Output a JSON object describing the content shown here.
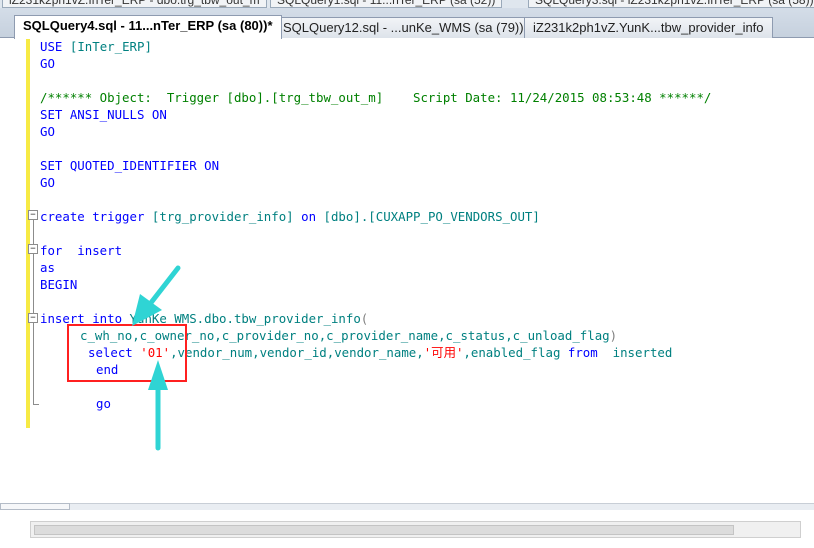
{
  "top_strip": {
    "tabs": [
      "iZ231k2ph1vZ.InTer_ERP - dbo.trg_tbw_out_m",
      "SQLQuery1.sql - 11...nTer_ERP (sa (52))",
      "SQLQuery3.sql - iZ231k2ph1vZ.InTer_ERP (sa (58))"
    ]
  },
  "tabs": [
    {
      "label": "SQLQuery4.sql - 11...nTer_ERP (sa (80))*",
      "active": true
    },
    {
      "label": "SQLQuery12.sql - ...unKe_WMS (sa (79))",
      "active": false
    },
    {
      "label": "iZ231k2ph1vZ.YunK...tbw_provider_info",
      "active": false
    }
  ],
  "code": {
    "l1_kw": "USE",
    "l1_db": "[InTer_ERP]",
    "l2_kw": "GO",
    "l4_comment": "/****** Object:  Trigger [dbo].[trg_tbw_out_m]    Script Date: 11/24/2015 08:53:48 ******/",
    "l5_kw": "SET ANSI_NULLS ON",
    "l6_kw": "GO",
    "l8_kw": "SET QUOTED_IDENTIFIER ON",
    "l9_kw": "GO",
    "l11_kw1": "create trigger",
    "l11_obj": "[trg_provider_info]",
    "l11_kw2": "on",
    "l11_tbl": "[dbo].[CUXAPP_PO_VENDORS_OUT]",
    "l13_kw": "for  insert",
    "l14_kw": "as",
    "l15_kw": "BEGIN",
    "l17_kw": "insert into",
    "l17_tbl": "YunKe_WMS.dbo.tbw_provider_info",
    "l17_paren": "(",
    "l18_cols": "c_wh_no,c_owner_no,c_provider_no,c_provider_name,c_status,c_unload_flag",
    "l18_paren": ")",
    "l19_kw": "select",
    "l19_str1": "'01'",
    "l19_rest": ",vendor_num,vendor_id,vendor_name,",
    "l19_str2": "'可用'",
    "l19_col": ",enabled_flag",
    "l19_kw2": "from",
    "l19_tbl": "inserted",
    "l20_kw": "end",
    "l22_kw": "go"
  },
  "fold_markers": [
    "−",
    "−",
    "−"
  ],
  "colors": {
    "keyword": "#0000ff",
    "comment": "#008000",
    "string": "#ff0000",
    "annotation": "#ff2020",
    "arrow": "#2fd4d4",
    "change_bar": "#f7ea44"
  }
}
